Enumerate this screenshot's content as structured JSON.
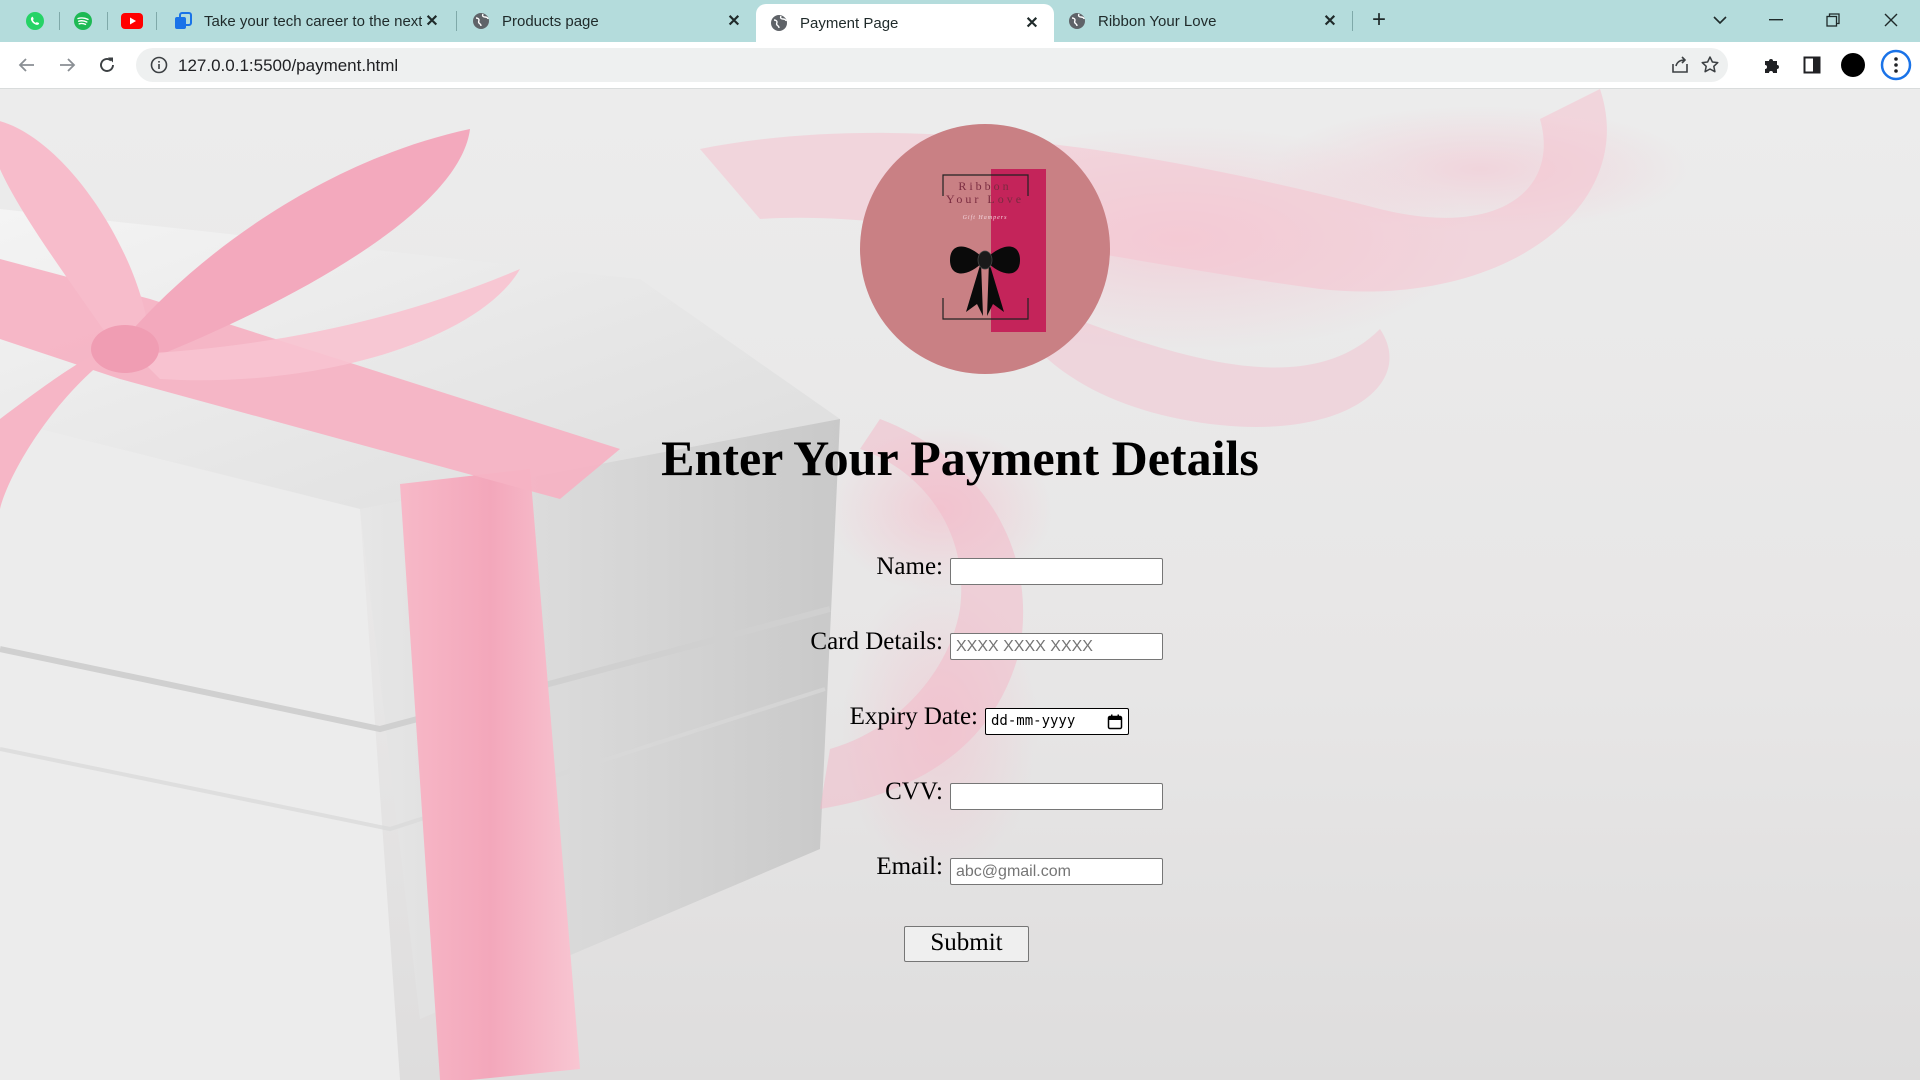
{
  "browser": {
    "pinned_tabs": [
      {
        "icon": "whatsapp-icon"
      },
      {
        "icon": "spotify-icon"
      },
      {
        "icon": "youtube-icon"
      }
    ],
    "tabs": [
      {
        "title": "Take your tech career to the next",
        "icon": "skillup-icon",
        "active": false
      },
      {
        "title": "Products page",
        "icon": "globe-icon",
        "active": false
      },
      {
        "title": "Payment Page",
        "icon": "globe-icon",
        "active": true
      },
      {
        "title": "Ribbon Your Love",
        "icon": "globe-icon",
        "active": false
      }
    ],
    "url": "127.0.0.1:5500/payment.html",
    "colors": {
      "tabbar": "#b4dcdc",
      "active_tab": "#ffffff"
    }
  },
  "page": {
    "logo": {
      "brand_lines": [
        "Ribbon",
        "Your Love"
      ],
      "tagline": "Gift Hampers",
      "circle_color": "#c98084",
      "band_color": "#c4245a"
    },
    "heading": "Enter Your Payment Details",
    "form": {
      "name_label": "Name:",
      "name_value": "",
      "card_label": "Card Details:",
      "card_placeholder": "XXXX XXXX XXXX",
      "expiry_label": "Expiry Date:",
      "expiry_placeholder": "dd-mm-yyyy",
      "cvv_label": "CVV:",
      "cvv_value": "",
      "email_label": "Email:",
      "email_placeholder": "abc@gmail.com",
      "submit_label": "Submit"
    }
  }
}
